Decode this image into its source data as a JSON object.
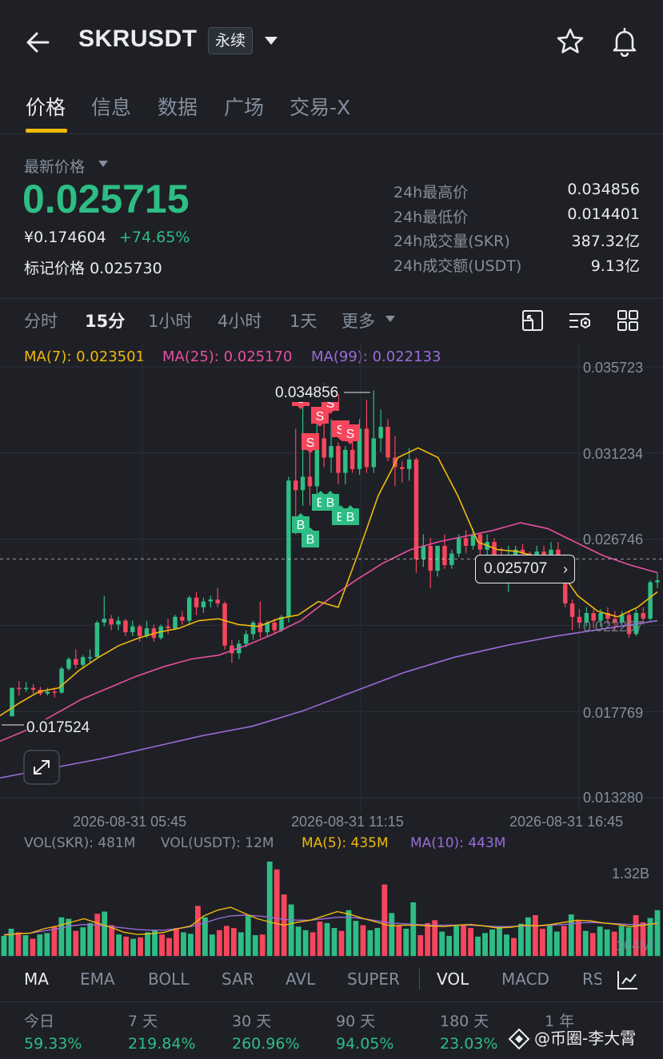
{
  "header": {
    "title": "SKRUSDT",
    "contract_badge": "永续",
    "icons": [
      "back-arrow-icon",
      "dropdown-triangle-icon",
      "star-icon",
      "bell-icon"
    ]
  },
  "tabs": [
    {
      "label": "价格",
      "active": true
    },
    {
      "label": "信息",
      "active": false
    },
    {
      "label": "数据",
      "active": false
    },
    {
      "label": "广场",
      "active": false
    },
    {
      "label": "交易-X",
      "active": false
    }
  ],
  "price": {
    "latest_label": "最新价格",
    "last_price": "0.025715",
    "cny_price": "¥0.174604",
    "change_pct": "+74.65%",
    "mark_label": "标记价格",
    "mark_price": "0.025730"
  },
  "stats": [
    {
      "label": "24h最高价",
      "value": "0.034856"
    },
    {
      "label": "24h最低价",
      "value": "0.014401"
    },
    {
      "label": "24h成交量(SKR)",
      "value": "387.32亿"
    },
    {
      "label": "24h成交额(USDT)",
      "value": "9.13亿"
    }
  ],
  "intervals": [
    {
      "label": "分时",
      "active": false
    },
    {
      "label": "15分",
      "active": true
    },
    {
      "label": "1小时",
      "active": false
    },
    {
      "label": "4小时",
      "active": false
    },
    {
      "label": "1天",
      "active": false
    },
    {
      "label": "更多",
      "active": false
    }
  ],
  "ma_legend": {
    "ma7": "MA(7): 0.023501",
    "ma25": "MA(25): 0.025170",
    "ma99": "MA(99): 0.022133"
  },
  "colors": {
    "up": "#2ebd85",
    "down": "#f6465d",
    "ma7": "#f0b90b",
    "ma25": "#e84fa0",
    "ma99": "#9b6bd8",
    "accent": "#f0b90b",
    "background": "#1e2026"
  },
  "y_axis_labels": [
    "0.035723",
    "0.031234",
    "0.026746",
    "0.022257",
    "0.017769",
    "0.013280"
  ],
  "x_axis_labels": [
    "2026-08-31 05:45",
    "2026-08-31 11:15",
    "2026-08-31 16:45"
  ],
  "annotations": {
    "high_label": "0.034856",
    "low_label": "0.017524",
    "current_price_tag": "0.025707",
    "buy_marker": "B",
    "sell_marker": "S"
  },
  "volume_legend": {
    "vol_skr": "VOL(SKR): 481M",
    "vol_usdt": "VOL(USDT): 12M",
    "ma5": "MA(5): 435M",
    "ma10": "MA(10): 443M",
    "top_label": "1.32B",
    "bottom_label": "164M"
  },
  "indicators": [
    {
      "label": "MA",
      "active": true
    },
    {
      "label": "EMA",
      "active": false
    },
    {
      "label": "BOLL",
      "active": false
    },
    {
      "label": "SAR",
      "active": false
    },
    {
      "label": "AVL",
      "active": false
    },
    {
      "label": "SUPER",
      "active": false
    },
    {
      "label": "VOL",
      "active": true
    },
    {
      "label": "MACD",
      "active": false
    },
    {
      "label": "RSI",
      "active": false
    }
  ],
  "performance": [
    {
      "label": "今日",
      "value": "59.33%"
    },
    {
      "label": "7 天",
      "value": "219.84%"
    },
    {
      "label": "30 天",
      "value": "260.96%"
    },
    {
      "label": "90 天",
      "value": "94.05%"
    },
    {
      "label": "180 天",
      "value": "23.03%"
    },
    {
      "label": "1 年",
      "value": ""
    }
  ],
  "watermark": "@币圈-李大霄",
  "chart_data": {
    "type": "candlestick",
    "interval": "15分",
    "ylim": [
      0.01328,
      0.035723
    ],
    "yticks": [
      0.035723,
      0.031234,
      0.026746,
      0.022257,
      0.017769,
      0.01328
    ],
    "candles": [
      [
        0.01752,
        0.019,
        0.01752,
        0.019
      ],
      [
        0.019,
        0.01935,
        0.0186,
        0.01895
      ],
      [
        0.01895,
        0.0193,
        0.0188,
        0.019
      ],
      [
        0.019,
        0.0192,
        0.0187,
        0.0189
      ],
      [
        0.0189,
        0.01905,
        0.0186,
        0.0187
      ],
      [
        0.0187,
        0.019,
        0.0186,
        0.0188
      ],
      [
        0.0188,
        0.019,
        0.0185,
        0.01875
      ],
      [
        0.01875,
        0.0201,
        0.0187,
        0.02
      ],
      [
        0.02,
        0.0206,
        0.0199,
        0.0205
      ],
      [
        0.0205,
        0.021,
        0.02,
        0.0202
      ],
      [
        0.0202,
        0.0207,
        0.02,
        0.0206
      ],
      [
        0.0206,
        0.021,
        0.0203,
        0.0206
      ],
      [
        0.0206,
        0.0225,
        0.0206,
        0.0224
      ],
      [
        0.0224,
        0.0238,
        0.0222,
        0.0226
      ],
      [
        0.0226,
        0.0228,
        0.022,
        0.0223
      ],
      [
        0.0223,
        0.0227,
        0.022,
        0.0225
      ],
      [
        0.0225,
        0.0226,
        0.0217,
        0.0219
      ],
      [
        0.0219,
        0.0225,
        0.0217,
        0.0222
      ],
      [
        0.0222,
        0.0223,
        0.0214,
        0.0217
      ],
      [
        0.0217,
        0.0225,
        0.0216,
        0.0221
      ],
      [
        0.0221,
        0.0223,
        0.0214,
        0.0216
      ],
      [
        0.0216,
        0.0223,
        0.0215,
        0.0222
      ],
      [
        0.0222,
        0.0226,
        0.0218,
        0.0221
      ],
      [
        0.0221,
        0.0228,
        0.022,
        0.0227
      ],
      [
        0.0227,
        0.023,
        0.0223,
        0.0225
      ],
      [
        0.0225,
        0.0238,
        0.0223,
        0.0237
      ],
      [
        0.0237,
        0.024,
        0.0228,
        0.0232
      ],
      [
        0.0232,
        0.0237,
        0.0229,
        0.0235
      ],
      [
        0.0235,
        0.0238,
        0.0232,
        0.0236
      ],
      [
        0.0236,
        0.0242,
        0.0232,
        0.0234
      ],
      [
        0.0234,
        0.0235,
        0.021,
        0.0212
      ],
      [
        0.0212,
        0.0215,
        0.0203,
        0.0208
      ],
      [
        0.0208,
        0.0215,
        0.0205,
        0.0213
      ],
      [
        0.0213,
        0.022,
        0.0211,
        0.0218
      ],
      [
        0.0218,
        0.0225,
        0.0215,
        0.0224
      ],
      [
        0.0224,
        0.0235,
        0.0216,
        0.0219
      ],
      [
        0.0219,
        0.0225,
        0.0217,
        0.0224
      ],
      [
        0.0224,
        0.0226,
        0.0218,
        0.022
      ],
      [
        0.022,
        0.0228,
        0.0219,
        0.0227
      ],
      [
        0.0227,
        0.03,
        0.0224,
        0.0298
      ],
      [
        0.0298,
        0.0325,
        0.027,
        0.0293
      ],
      [
        0.0293,
        0.0348,
        0.0285,
        0.03
      ],
      [
        0.03,
        0.032,
        0.0285,
        0.0295
      ],
      [
        0.0295,
        0.033,
        0.0285,
        0.032
      ],
      [
        0.032,
        0.03486,
        0.0305,
        0.031
      ],
      [
        0.031,
        0.033,
        0.0302,
        0.0316
      ],
      [
        0.0316,
        0.0318,
        0.0296,
        0.0302
      ],
      [
        0.0302,
        0.0316,
        0.0296,
        0.0314
      ],
      [
        0.0314,
        0.0322,
        0.0302,
        0.0304
      ],
      [
        0.0304,
        0.033,
        0.0301,
        0.0325
      ],
      [
        0.0325,
        0.034,
        0.0302,
        0.0305
      ],
      [
        0.0305,
        0.0345,
        0.0302,
        0.032
      ],
      [
        0.032,
        0.0335,
        0.0313,
        0.0326
      ],
      [
        0.0326,
        0.033,
        0.0308,
        0.031
      ],
      [
        0.031,
        0.0321,
        0.0295,
        0.0305
      ],
      [
        0.0305,
        0.0308,
        0.0297,
        0.0304
      ],
      [
        0.0304,
        0.0315,
        0.0298,
        0.0309
      ],
      [
        0.0309,
        0.031,
        0.025,
        0.0257
      ],
      [
        0.0257,
        0.027,
        0.0253,
        0.0264
      ],
      [
        0.0264,
        0.0268,
        0.0242,
        0.0251
      ],
      [
        0.0251,
        0.0264,
        0.0248,
        0.0264
      ],
      [
        0.0264,
        0.027,
        0.0252,
        0.0254
      ],
      [
        0.0254,
        0.0262,
        0.0252,
        0.026
      ],
      [
        0.026,
        0.027,
        0.0258,
        0.0268
      ],
      [
        0.0268,
        0.0272,
        0.026,
        0.0264
      ],
      [
        0.0264,
        0.0273,
        0.0262,
        0.027
      ],
      [
        0.027,
        0.0271,
        0.0258,
        0.0262
      ],
      [
        0.0262,
        0.027,
        0.0259,
        0.0266
      ],
      [
        0.0266,
        0.0268,
        0.0255,
        0.0259
      ],
      [
        0.0259,
        0.0263,
        0.0252,
        0.0257
      ],
      [
        0.0257,
        0.0264,
        0.024,
        0.0258
      ],
      [
        0.0258,
        0.0264,
        0.025,
        0.0262
      ],
      [
        0.0262,
        0.0265,
        0.0256,
        0.026
      ],
      [
        0.026,
        0.0261,
        0.0254,
        0.0258
      ],
      [
        0.0258,
        0.0264,
        0.0254,
        0.0261
      ],
      [
        0.0261,
        0.0264,
        0.0257,
        0.0259
      ],
      [
        0.0259,
        0.0266,
        0.0256,
        0.0262
      ],
      [
        0.0262,
        0.0266,
        0.0248,
        0.025
      ],
      [
        0.025,
        0.0253,
        0.0232,
        0.0234
      ],
      [
        0.0234,
        0.0236,
        0.022,
        0.0227
      ],
      [
        0.0227,
        0.0231,
        0.0221,
        0.0224
      ],
      [
        0.0224,
        0.0232,
        0.0222,
        0.0229
      ],
      [
        0.0229,
        0.0231,
        0.0221,
        0.0225
      ],
      [
        0.0225,
        0.0231,
        0.0222,
        0.0229
      ],
      [
        0.0229,
        0.0232,
        0.0223,
        0.0226
      ],
      [
        0.0226,
        0.023,
        0.022,
        0.0224
      ],
      [
        0.0224,
        0.023,
        0.0222,
        0.0228
      ],
      [
        0.0228,
        0.023,
        0.0216,
        0.0218
      ],
      [
        0.0218,
        0.0231,
        0.0217,
        0.0229
      ],
      [
        0.0229,
        0.0232,
        0.0223,
        0.0226
      ],
      [
        0.0226,
        0.0246,
        0.0225,
        0.0245
      ],
      [
        0.0245,
        0.025,
        0.0242,
        0.0246
      ]
    ],
    "ma7": [
      0.01752,
      0.0182,
      0.0188,
      0.019,
      0.0199,
      0.0206,
      0.0212,
      0.0216,
      0.0219,
      0.0221,
      0.0225,
      0.0226,
      0.0223,
      0.0222,
      0.0226,
      0.0228,
      0.0235,
      0.0232,
      0.026,
      0.029,
      0.031,
      0.0315,
      0.031,
      0.029,
      0.0266,
      0.0262,
      0.0261,
      0.0258,
      0.0253,
      0.0238,
      0.023,
      0.0227,
      0.0232,
      0.024
    ],
    "ma25": [
      0.0162,
      0.0168,
      0.0176,
      0.0184,
      0.019,
      0.0196,
      0.0201,
      0.0205,
      0.0207,
      0.0212,
      0.0218,
      0.0225,
      0.0236,
      0.0246,
      0.0255,
      0.0262,
      0.0266,
      0.0269,
      0.0272,
      0.0276,
      0.0273,
      0.0266,
      0.0259,
      0.0254,
      0.025
    ],
    "ma99": [
      0.0143,
      0.0148,
      0.0153,
      0.0159,
      0.0165,
      0.017,
      0.0178,
      0.0188,
      0.0198,
      0.0206,
      0.0212,
      0.0217,
      0.0221,
      0.0225
    ],
    "volume": {
      "ylim": [
        0,
        1320
      ],
      "unit": "M",
      "bars": [
        [
          280,
          1
        ],
        [
          380,
          1
        ],
        [
          330,
          0
        ],
        [
          290,
          1
        ],
        [
          240,
          0
        ],
        [
          300,
          1
        ],
        [
          320,
          1
        ],
        [
          410,
          0
        ],
        [
          540,
          1
        ],
        [
          520,
          1
        ],
        [
          350,
          0
        ],
        [
          400,
          1
        ],
        [
          460,
          1
        ],
        [
          590,
          0
        ],
        [
          620,
          1
        ],
        [
          430,
          0
        ],
        [
          300,
          1
        ],
        [
          270,
          0
        ],
        [
          240,
          1
        ],
        [
          260,
          0
        ],
        [
          330,
          1
        ],
        [
          360,
          1
        ],
        [
          300,
          0
        ],
        [
          250,
          0
        ],
        [
          390,
          0
        ],
        [
          330,
          1
        ],
        [
          310,
          1
        ],
        [
          700,
          0
        ],
        [
          540,
          1
        ],
        [
          300,
          1
        ],
        [
          360,
          0
        ],
        [
          420,
          0
        ],
        [
          390,
          0
        ],
        [
          330,
          1
        ],
        [
          560,
          1
        ],
        [
          290,
          1
        ],
        [
          300,
          0
        ],
        [
          1320,
          1
        ],
        [
          1210,
          0
        ],
        [
          860,
          0
        ],
        [
          720,
          1
        ],
        [
          410,
          1
        ],
        [
          360,
          1
        ],
        [
          330,
          0
        ],
        [
          480,
          0
        ],
        [
          460,
          1
        ],
        [
          390,
          1
        ],
        [
          350,
          0
        ],
        [
          640,
          1
        ],
        [
          490,
          1
        ],
        [
          430,
          0
        ],
        [
          360,
          1
        ],
        [
          390,
          1
        ],
        [
          1000,
          0
        ],
        [
          600,
          1
        ],
        [
          420,
          0
        ],
        [
          380,
          1
        ],
        [
          750,
          1
        ],
        [
          290,
          0
        ],
        [
          460,
          0
        ],
        [
          500,
          0
        ],
        [
          340,
          1
        ],
        [
          280,
          1
        ],
        [
          420,
          1
        ],
        [
          430,
          0
        ],
        [
          390,
          0
        ],
        [
          270,
          1
        ],
        [
          320,
          1
        ],
        [
          370,
          1
        ],
        [
          410,
          1
        ],
        [
          300,
          1
        ],
        [
          250,
          0
        ],
        [
          450,
          1
        ],
        [
          540,
          1
        ],
        [
          570,
          0
        ],
        [
          380,
          0
        ],
        [
          430,
          1
        ],
        [
          340,
          1
        ],
        [
          420,
          0
        ],
        [
          580,
          1
        ],
        [
          500,
          0
        ],
        [
          350,
          1
        ],
        [
          320,
          0
        ],
        [
          410,
          1
        ],
        [
          370,
          1
        ],
        [
          340,
          0
        ],
        [
          420,
          1
        ],
        [
          400,
          1
        ],
        [
          570,
          0
        ],
        [
          470,
          0
        ],
        [
          530,
          1
        ],
        [
          640,
          1
        ]
      ],
      "ma5": [
        290,
        310,
        320,
        380,
        420,
        470,
        520,
        460,
        400,
        330,
        300,
        310,
        330,
        380,
        420,
        560,
        640,
        680,
        600,
        520,
        470,
        430,
        470,
        500,
        560,
        620,
        580,
        520,
        470,
        420,
        430,
        430,
        420,
        410,
        430,
        440,
        420,
        390,
        400,
        430,
        420,
        440,
        470,
        500,
        490,
        460,
        440,
        410,
        430,
        460
      ],
      "ma10": [
        300,
        310,
        320,
        350,
        380,
        420,
        440,
        430,
        410,
        390,
        370,
        360,
        360,
        380,
        410,
        460,
        520,
        560,
        570,
        560,
        540,
        510,
        500,
        500,
        520,
        540,
        540,
        520,
        490,
        460,
        450,
        440,
        430,
        430,
        430,
        430,
        420,
        410,
        410,
        420,
        420,
        430,
        440,
        460,
        470,
        460,
        450,
        440,
        440,
        450
      ]
    }
  }
}
